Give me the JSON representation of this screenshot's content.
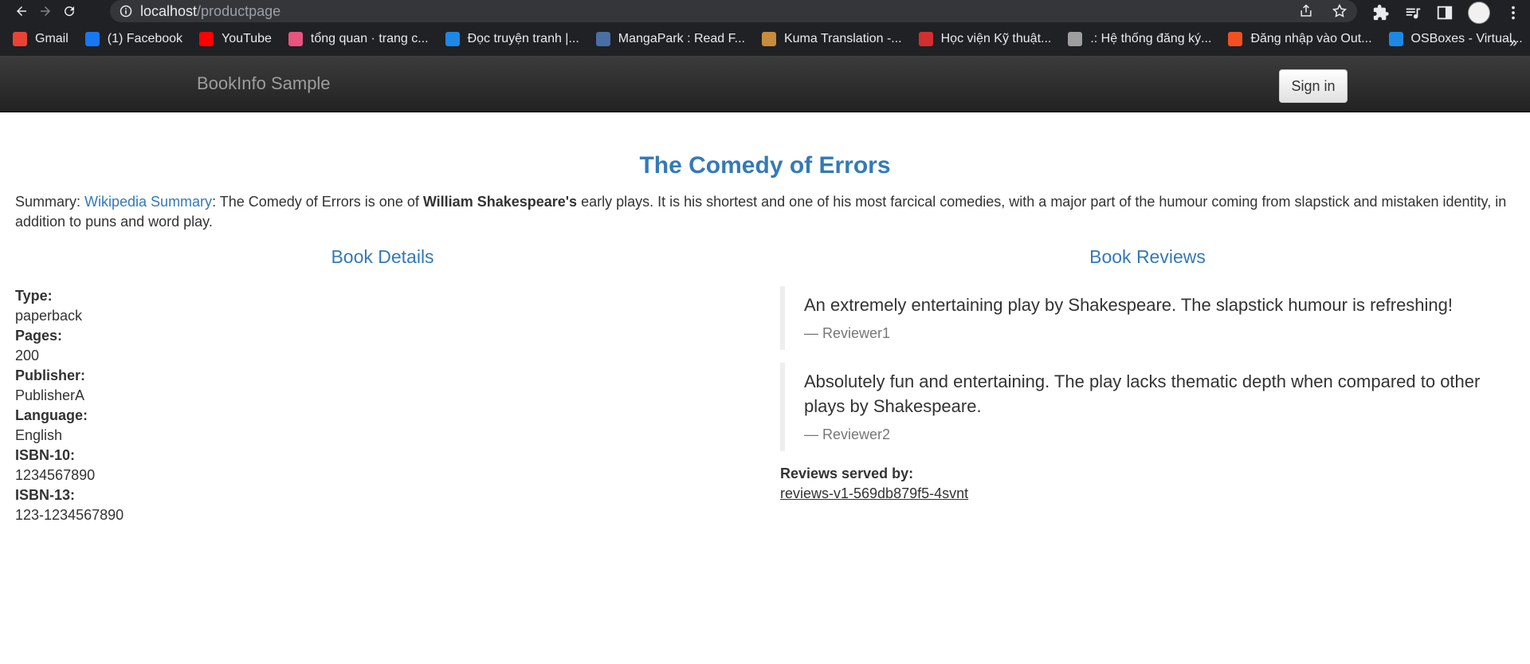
{
  "browser": {
    "url_host": "localhost",
    "url_path": "/productpage",
    "bookmarks": [
      {
        "label": "Gmail",
        "icon": "gmail-icon",
        "color": "#ea4335"
      },
      {
        "label": "(1) Facebook",
        "icon": "facebook-icon",
        "color": "#1877f2"
      },
      {
        "label": "YouTube",
        "icon": "youtube-icon",
        "color": "#ff0000"
      },
      {
        "label": "tổng quan · trang c...",
        "icon": "site-icon",
        "color": "#e75480"
      },
      {
        "label": "Đọc truyện tranh |...",
        "icon": "comic-icon",
        "color": "#1e88e5"
      },
      {
        "label": "MangaPark : Read F...",
        "icon": "mangapark-icon",
        "color": "#4a6fa5"
      },
      {
        "label": "Kuma Translation -...",
        "icon": "kuma-icon",
        "color": "#c98b3c"
      },
      {
        "label": "Học viện Kỹ thuật...",
        "icon": "academy-icon",
        "color": "#d32f2f"
      },
      {
        "label": ".: Hệ thống đăng ký...",
        "icon": "globe-icon",
        "color": "#9e9e9e"
      },
      {
        "label": "Đăng nhập vào Out...",
        "icon": "microsoft-icon",
        "color": "#f25022"
      },
      {
        "label": "OSBoxes - Virtual...",
        "icon": "osboxes-icon",
        "color": "#1e88e5"
      }
    ],
    "more": "»"
  },
  "navbar": {
    "brand": "BookInfo Sample",
    "signin": "Sign in"
  },
  "product": {
    "title": "The Comedy of Errors",
    "summary_prefix": "Summary: ",
    "summary_link": "Wikipedia Summary",
    "summary_mid": ": The Comedy of Errors is one of ",
    "summary_bold": "William Shakespeare's",
    "summary_rest": " early plays. It is his shortest and one of his most farcical comedies, with a major part of the humour coming from slapstick and mistaken identity, in addition to puns and word play."
  },
  "details": {
    "heading": "Book Details",
    "items": [
      {
        "label": "Type:",
        "value": "paperback"
      },
      {
        "label": "Pages:",
        "value": "200"
      },
      {
        "label": "Publisher:",
        "value": "PublisherA"
      },
      {
        "label": "Language:",
        "value": "English"
      },
      {
        "label": "ISBN-10:",
        "value": "1234567890"
      },
      {
        "label": "ISBN-13:",
        "value": "123-1234567890"
      }
    ]
  },
  "reviews": {
    "heading": "Book Reviews",
    "items": [
      {
        "text": "An extremely entertaining play by Shakespeare. The slapstick humour is refreshing!",
        "by": "— Reviewer1"
      },
      {
        "text": "Absolutely fun and entertaining. The play lacks thematic depth when compared to other plays by Shakespeare.",
        "by": "— Reviewer2"
      }
    ],
    "served_label": "Reviews served by:",
    "served_host": "reviews-v1-569db879f5-4svnt"
  }
}
